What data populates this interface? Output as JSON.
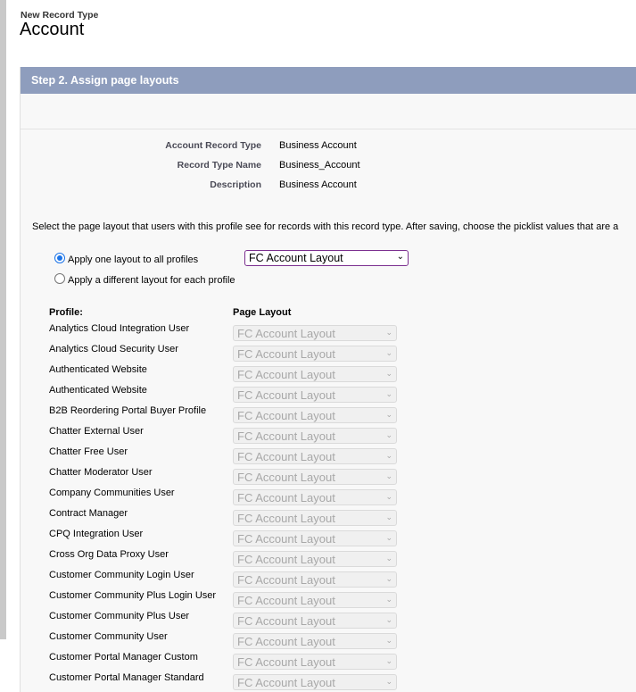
{
  "header": {
    "kicker": "New Record Type",
    "title": "Account"
  },
  "step": {
    "title": "Step 2. Assign page layouts"
  },
  "info": [
    {
      "label": "Account Record Type",
      "value": "Business Account"
    },
    {
      "label": "Record Type Name",
      "value": "Business_Account"
    },
    {
      "label": "Description",
      "value": "Business Account"
    }
  ],
  "instructions": "Select the page layout that users with this profile see for records with this record type. After saving, choose the picklist values that are a",
  "options": {
    "one_layout_label": "Apply one layout to all profiles",
    "one_layout_selected": true,
    "different_layout_label": "Apply a different layout for each profile",
    "main_layout_value": "FC Account Layout"
  },
  "table": {
    "profile_header": "Profile:",
    "layout_header": "Page Layout",
    "rows": [
      {
        "profile": "Analytics Cloud Integration User",
        "layout": "FC Account Layout"
      },
      {
        "profile": "Analytics Cloud Security User",
        "layout": "FC Account Layout"
      },
      {
        "profile": "Authenticated Website",
        "layout": "FC Account Layout"
      },
      {
        "profile": "Authenticated Website",
        "layout": "FC Account Layout"
      },
      {
        "profile": "B2B Reordering Portal Buyer Profile",
        "layout": "FC Account Layout"
      },
      {
        "profile": "Chatter External User",
        "layout": "FC Account Layout"
      },
      {
        "profile": "Chatter Free User",
        "layout": "FC Account Layout"
      },
      {
        "profile": "Chatter Moderator User",
        "layout": "FC Account Layout"
      },
      {
        "profile": "Company Communities User",
        "layout": "FC Account Layout"
      },
      {
        "profile": "Contract Manager",
        "layout": "FC Account Layout"
      },
      {
        "profile": "CPQ Integration User",
        "layout": "FC Account Layout"
      },
      {
        "profile": "Cross Org Data Proxy User",
        "layout": "FC Account Layout"
      },
      {
        "profile": "Customer Community Login User",
        "layout": "FC Account Layout"
      },
      {
        "profile": "Customer Community Plus Login User",
        "layout": "FC Account Layout"
      },
      {
        "profile": "Customer Community Plus User",
        "layout": "FC Account Layout"
      },
      {
        "profile": "Customer Community User",
        "layout": "FC Account Layout"
      },
      {
        "profile": "Customer Portal Manager Custom",
        "layout": "FC Account Layout"
      },
      {
        "profile": "Customer Portal Manager Standard",
        "layout": "FC Account Layout"
      }
    ]
  },
  "icons": {
    "chevron": "chevron-down-icon"
  }
}
